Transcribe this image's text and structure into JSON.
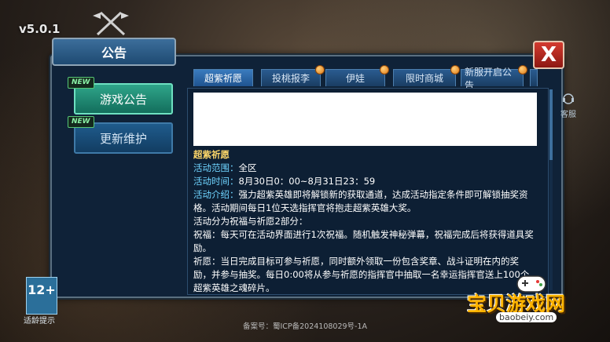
{
  "app": {
    "version": "v5.0.1"
  },
  "panel": {
    "title": "公告",
    "close_label": "X"
  },
  "sidebar": {
    "items": [
      {
        "label": "游戏公告",
        "badge": "NEW",
        "active": true
      },
      {
        "label": "更新维护",
        "badge": "NEW",
        "active": false
      }
    ]
  },
  "tabs": [
    {
      "label": "超紫祈愿"
    },
    {
      "label": "投桃报李"
    },
    {
      "label": "伊娃"
    },
    {
      "label": "限时商城"
    },
    {
      "label": "新服开启公告"
    }
  ],
  "article": {
    "heading": "超紫祈愿",
    "scope_key": "活动范围：",
    "scope_val": "全区",
    "time_key": "活动时间：",
    "time_val": "8月30日0：00~8月31日23：59",
    "intro_key": "活动介绍：",
    "intro_val": "强力超紫英雄即将解锁新的获取通道，达成活动指定条件即可解锁抽奖资格。活动期间每日1位天选指挥官将抱走超紫英雄大奖。",
    "parts": "活动分为祝福与祈愿2部分：",
    "bless": "祝福：每天可在活动界面进行1次祝福。随机触发神秘弹幕，祝福完成后将获得道具奖励。",
    "pray": "祈愿：当日完成目标可参与祈愿，同时额外领取一份包含奖章、战斗证明在内的奖励，并参与抽奖。每日0:00将从参与祈愿的指挥官中抽取一名幸运指挥官送上100个超紫英雄之魂碎片。"
  },
  "side_service": {
    "label": "客服"
  },
  "age": {
    "rating": "12+",
    "tip": "适龄提示"
  },
  "footer": {
    "icp": "备案号：蜀ICP备2024108029号-1A"
  },
  "watermark": {
    "main": "宝贝游戏网",
    "sub": "baobeiy.com"
  }
}
